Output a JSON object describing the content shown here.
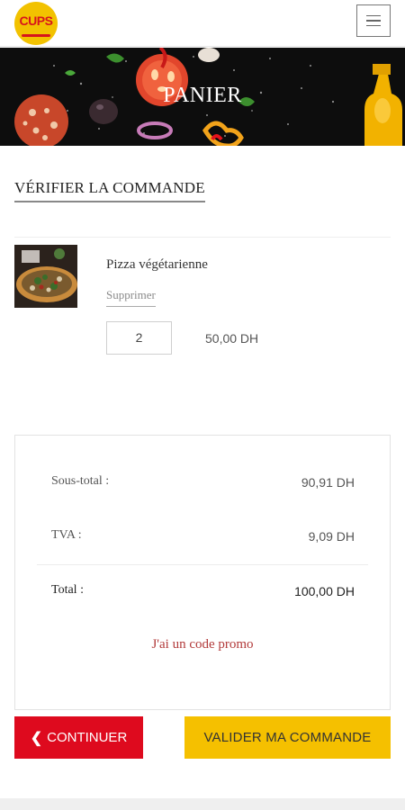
{
  "header": {
    "logo_text": "CUPS",
    "menu_icon": "hamburger-icon"
  },
  "banner": {
    "title": "PANIER"
  },
  "section": {
    "title": "VÉRIFIER LA COMMANDE"
  },
  "cart": {
    "items": [
      {
        "name": "Pizza végétarienne",
        "remove_label": "Supprimer",
        "quantity": "2",
        "price": "50,00 DH"
      }
    ]
  },
  "summary": {
    "subtotal_label": "Sous-total :",
    "subtotal_value": "90,91 DH",
    "tax_label": "TVA :",
    "tax_value": "9,09 DH",
    "total_label": "Total :",
    "total_value": "100,00 DH",
    "promo_label": "J'ai un code promo"
  },
  "actions": {
    "continue_label": "CONTINUER",
    "continue_icon": "chevron-left-icon",
    "validate_label": "VALIDER MA COMMANDE"
  },
  "colors": {
    "red": "#de0a1e",
    "yellow": "#f5c000",
    "promo": "#b23a3a",
    "banner_bg": "#0d0d0d"
  }
}
